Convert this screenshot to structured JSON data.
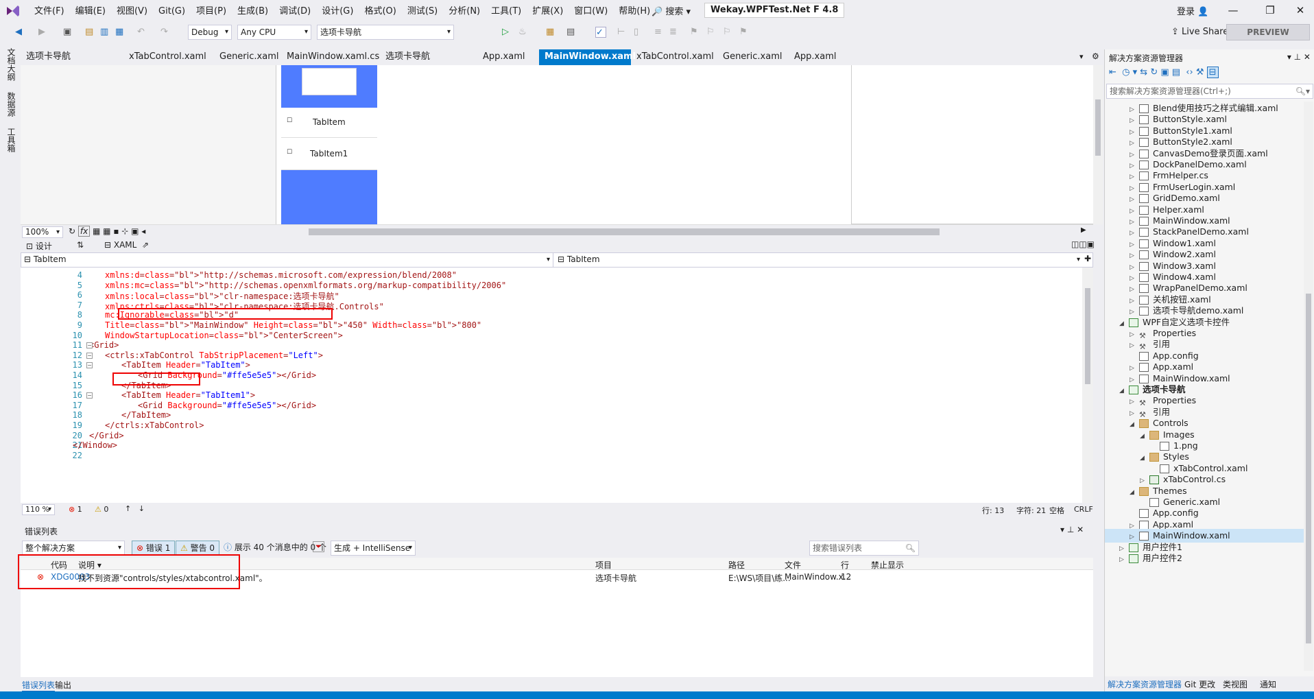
{
  "menu": [
    "文件(F)",
    "编辑(E)",
    "视图(V)",
    "Git(G)",
    "项目(P)",
    "生成(B)",
    "调试(D)",
    "设计(G)",
    "格式(O)",
    "测试(S)",
    "分析(N)",
    "工具(T)",
    "扩展(X)",
    "窗口(W)",
    "帮助(H)"
  ],
  "search_label": "搜索",
  "solution_title": "Wekay.WPFTest.Net F 4.8",
  "login": "登录",
  "toolbar": {
    "config": "Debug",
    "platform": "Any CPU",
    "startup": "选项卡导航",
    "start": "启动",
    "liveshare": "Live Share",
    "preview": "PREVIEW"
  },
  "leftstrip": [
    "文档大纲",
    "数据源",
    "工具箱"
  ],
  "tabs": [
    "选项卡导航demo.xaml.cs",
    "xTabControl.xaml",
    "Generic.xaml",
    "MainWindow.xaml.cs",
    "选项卡导航demo.xaml",
    "App.xaml",
    "MainWindow.xaml",
    "xTabControl.xaml",
    "Generic.xaml",
    "App.xaml"
  ],
  "active_tab_index": 6,
  "designer": {
    "tab1": "TabItem",
    "tab2": "TabItem1"
  },
  "zoom": "100%",
  "split": {
    "design": "设计",
    "xaml": "XAML"
  },
  "nav": {
    "left": "TabItem",
    "right": "TabItem"
  },
  "code_lines": [
    {
      "n": "4",
      "t": "xmlns:d=\"http://schemas.microsoft.com/expression/blend/2008\""
    },
    {
      "n": "5",
      "t": "xmlns:mc=\"http://schemas.openxmlformats.org/markup-compatibility/2006\""
    },
    {
      "n": "6",
      "t": "xmlns:local=\"clr-namespace:选项卡导航\""
    },
    {
      "n": "7",
      "t": "xmlns:ctrls=\"clr-namespace:选项卡导航.Controls\""
    },
    {
      "n": "8",
      "t": "mc:Ignorable=\"d\""
    },
    {
      "n": "9",
      "t": "Title=\"MainWindow\" Height=\"450\" Width=\"800\""
    },
    {
      "n": "10",
      "t": "WindowStartupLocation=\"CenterScreen\">"
    },
    {
      "n": "11",
      "t": "<Grid>"
    },
    {
      "n": "12",
      "t": "<ctrls:xTabControl TabStripPlacement=\"Left\">"
    },
    {
      "n": "13",
      "t": "<TabItem Header=\"TabItem\">"
    },
    {
      "n": "14",
      "t": "<Grid Background=\"#ffe5e5e5\"></Grid>"
    },
    {
      "n": "15",
      "t": "</TabItem>"
    },
    {
      "n": "16",
      "t": "<TabItem Header=\"TabItem1\">"
    },
    {
      "n": "17",
      "t": "<Grid Background=\"#ffe5e5e5\"></Grid>"
    },
    {
      "n": "18",
      "t": "</TabItem>"
    },
    {
      "n": "19",
      "t": "</ctrls:xTabControl>"
    },
    {
      "n": "20",
      "t": "</Grid>"
    },
    {
      "n": "21",
      "t": "</Window>"
    },
    {
      "n": "22",
      "t": ""
    }
  ],
  "editor_status": {
    "zoom": "110 %",
    "errors": "1",
    "warnings": "0",
    "line": "行: 13",
    "col": "字符: 21",
    "space": "空格",
    "eol": "CRLF"
  },
  "errlist": {
    "title": "错误列表",
    "scope": "整个解决方案",
    "errors_btn": "错误 1",
    "warnings_btn": "警告 0",
    "messages": "展示 40 个消息中的 0 个",
    "build": "生成 + IntelliSense",
    "search": "搜索错误列表",
    "cols": [
      "代码",
      "说明",
      "项目",
      "路径",
      "文件",
      "行",
      "禁止显示"
    ],
    "row": {
      "code": "XDG0003",
      "desc": "找不到资源\"controls/styles/xtabcontrol.xaml\"。",
      "project": "选项卡导航",
      "path": "E:\\WS\\项目\\练...",
      "file": "MainWindow.x...",
      "line": "12"
    }
  },
  "bottom_tabs": [
    "错误列表",
    "输出"
  ],
  "se": {
    "title": "解决方案资源管理器",
    "search": "搜索解决方案资源管理器(Ctrl+;)",
    "bottom": [
      "解决方案资源管理器",
      "Git 更改",
      "类视图",
      "通知"
    ]
  },
  "tree": [
    {
      "l": "Blend使用技巧之样式编辑.xaml",
      "d": 2,
      "t": "f"
    },
    {
      "l": "ButtonStyle.xaml",
      "d": 2,
      "t": "f"
    },
    {
      "l": "ButtonStyle1.xaml",
      "d": 2,
      "t": "f"
    },
    {
      "l": "ButtonStyle2.xaml",
      "d": 2,
      "t": "f"
    },
    {
      "l": "CanvasDemo登录页面.xaml",
      "d": 2,
      "t": "f"
    },
    {
      "l": "DockPanelDemo.xaml",
      "d": 2,
      "t": "f"
    },
    {
      "l": "FrmHelper.cs",
      "d": 2,
      "t": "f"
    },
    {
      "l": "FrmUserLogin.xaml",
      "d": 2,
      "t": "f"
    },
    {
      "l": "GridDemo.xaml",
      "d": 2,
      "t": "f"
    },
    {
      "l": "Helper.xaml",
      "d": 2,
      "t": "f"
    },
    {
      "l": "MainWindow.xaml",
      "d": 2,
      "t": "f"
    },
    {
      "l": "StackPanelDemo.xaml",
      "d": 2,
      "t": "f"
    },
    {
      "l": "Window1.xaml",
      "d": 2,
      "t": "f"
    },
    {
      "l": "Window2.xaml",
      "d": 2,
      "t": "f"
    },
    {
      "l": "Window3.xaml",
      "d": 2,
      "t": "f"
    },
    {
      "l": "Window4.xaml",
      "d": 2,
      "t": "f"
    },
    {
      "l": "WrapPanelDemo.xaml",
      "d": 2,
      "t": "f"
    },
    {
      "l": "关机按钮.xaml",
      "d": 2,
      "t": "f"
    },
    {
      "l": "选项卡导航demo.xaml",
      "d": 2,
      "t": "f"
    },
    {
      "l": "WPF自定义选项卡控件",
      "d": 1,
      "t": "p",
      "o": true
    },
    {
      "l": "Properties",
      "d": 2,
      "t": "w"
    },
    {
      "l": "引用",
      "d": 2,
      "t": "w"
    },
    {
      "l": "App.config",
      "d": 2,
      "t": "f",
      "n": true
    },
    {
      "l": "App.xaml",
      "d": 2,
      "t": "f"
    },
    {
      "l": "MainWindow.xaml",
      "d": 2,
      "t": "f"
    },
    {
      "l": "选项卡导航",
      "d": 1,
      "t": "p",
      "o": true,
      "b": true
    },
    {
      "l": "Properties",
      "d": 2,
      "t": "w"
    },
    {
      "l": "引用",
      "d": 2,
      "t": "w"
    },
    {
      "l": "Controls",
      "d": 2,
      "t": "d",
      "o": true
    },
    {
      "l": "Images",
      "d": 3,
      "t": "d",
      "o": true
    },
    {
      "l": "1.png",
      "d": 4,
      "t": "f",
      "n": true
    },
    {
      "l": "Styles",
      "d": 3,
      "t": "d",
      "o": true
    },
    {
      "l": "xTabControl.xaml",
      "d": 4,
      "t": "f",
      "n": true
    },
    {
      "l": "xTabControl.cs",
      "d": 3,
      "t": "c"
    },
    {
      "l": "Themes",
      "d": 2,
      "t": "d",
      "o": true
    },
    {
      "l": "Generic.xaml",
      "d": 3,
      "t": "f",
      "n": true
    },
    {
      "l": "App.config",
      "d": 2,
      "t": "f",
      "n": true
    },
    {
      "l": "App.xaml",
      "d": 2,
      "t": "f"
    },
    {
      "l": "MainWindow.xaml",
      "d": 2,
      "t": "f",
      "s": true
    },
    {
      "l": "用户控件1",
      "d": 1,
      "t": "p"
    },
    {
      "l": "用户控件2",
      "d": 1,
      "t": "p"
    }
  ],
  "colors": {
    "accent": "#007acc",
    "tab_blue": "#4f7cff",
    "error": "#e51400"
  }
}
